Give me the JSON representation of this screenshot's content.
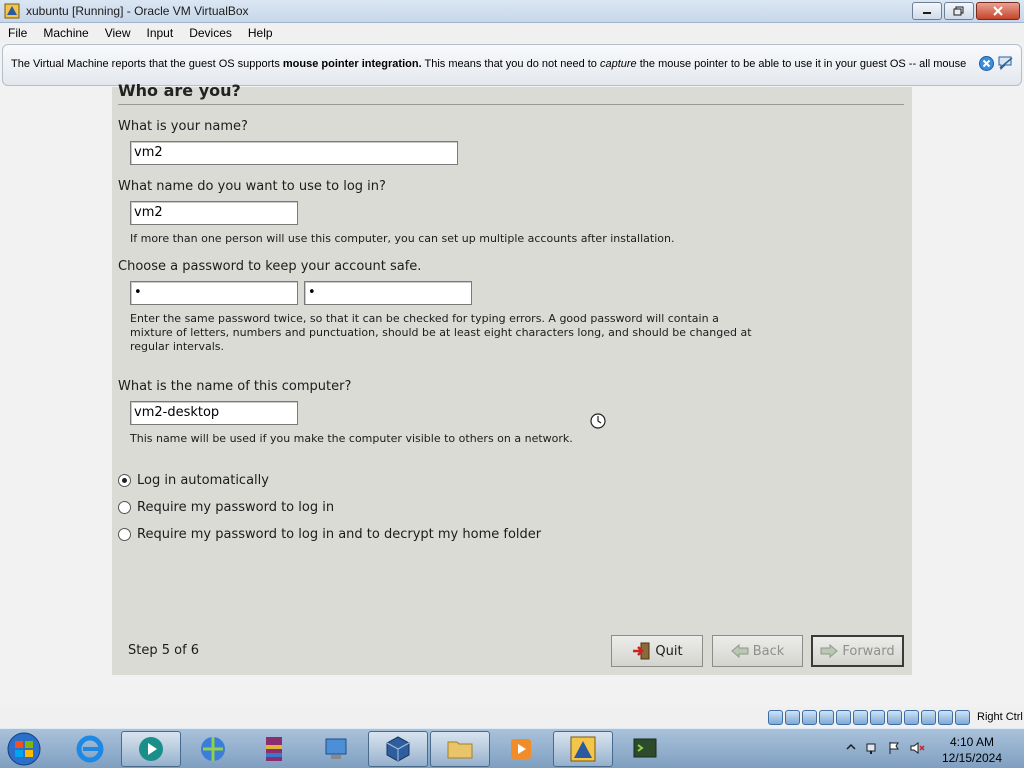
{
  "window": {
    "title": "xubuntu [Running] - Oracle VM VirtualBox"
  },
  "menubar": {
    "items": [
      "File",
      "Machine",
      "View",
      "Input",
      "Devices",
      "Help"
    ]
  },
  "notification": {
    "text_before": "The Virtual Machine reports that the guest OS supports ",
    "bold": "mouse pointer integration.",
    "text_middle": " This means that you do not need to ",
    "italic": "capture",
    "text_after": " the mouse pointer to be able to use it in your guest OS -- all mouse"
  },
  "installer": {
    "heading": "Who are you?",
    "name_label": "What is your name?",
    "name_value": "vm2",
    "login_label": "What name do you want to use to log in?",
    "login_value": "vm2",
    "login_hint": "If more than one person will use this computer, you can set up multiple accounts after installation.",
    "password_label": "Choose a password to keep your account safe.",
    "password_value": "•",
    "password_confirm_value": "•",
    "password_hint_line1": "Enter the same password twice, so that it can be checked for typing errors. A good password will contain a",
    "password_hint_line2": "mixture of letters, numbers and punctuation, should be at least eight characters long, and should be changed at",
    "password_hint_line3": "regular intervals.",
    "computer_label": "What is the name of this computer?",
    "computer_value": "vm2-desktop",
    "computer_hint": "This name will be used if you make the computer visible to others on a network.",
    "login_options": [
      {
        "label": "Log in automatically",
        "selected": true
      },
      {
        "label": "Require my password to log in",
        "selected": false
      },
      {
        "label": "Require my password to log in and to decrypt my home folder",
        "selected": false
      }
    ],
    "step": "Step 5 of 6",
    "buttons": {
      "quit": "Quit",
      "back": "Back",
      "forward": "Forward"
    }
  },
  "statusbar": {
    "host_key": "Right Ctrl"
  },
  "taskbar": {
    "time": "4:10 AM",
    "date": "12/15/2024"
  },
  "colors": {
    "panel_bg": "#dbdbd6",
    "taskbar": "#8fadcc",
    "accent": "#3d6fa7"
  }
}
